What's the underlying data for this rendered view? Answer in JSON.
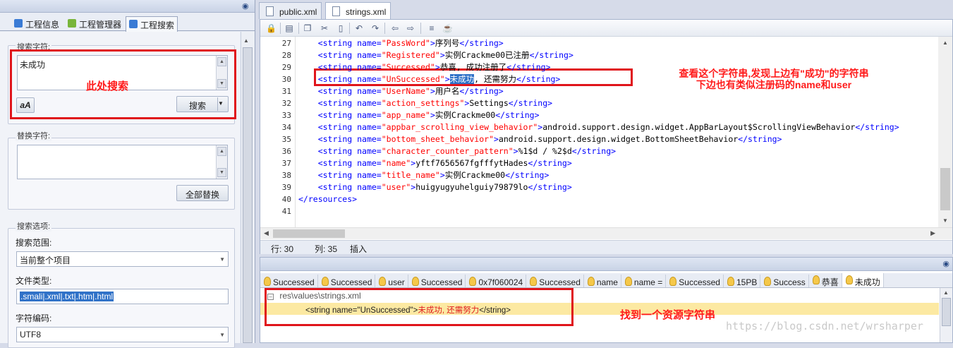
{
  "left_panel": {
    "tabs": [
      {
        "label": "工程信息",
        "icon": "info-icon",
        "color": "#3a7bd5"
      },
      {
        "label": "工程管理器",
        "icon": "android-icon",
        "color": "#78b53a"
      },
      {
        "label": "工程搜索",
        "icon": "search-icon",
        "color": "#3a7bd5"
      }
    ],
    "search_group_label": "搜索字符:",
    "search_text": "未成功",
    "font_button": "aA",
    "search_button": "搜索",
    "replace_group_label": "替换字符:",
    "replace_text": "",
    "replace_all_button": "全部替换",
    "options_group_label": "搜索选项:",
    "scope_label": "搜索范围:",
    "scope_value": "当前整个项目",
    "filetype_label": "文件类型:",
    "filetype_value": ".smali|.xml|.txt|.htm|.html",
    "encoding_label": "字符编码:",
    "encoding_value": "UTF8"
  },
  "annotations": {
    "search_here": "此处搜索",
    "note_line1": "查看这个字符串,发现上边有\"成功\"的字符串",
    "note_line2": "下边也有类似注册码的name和user",
    "found": "找到一个资源字符串"
  },
  "editor": {
    "tabs": [
      {
        "label": "public.xml",
        "active": false
      },
      {
        "label": "strings.xml",
        "active": true
      }
    ],
    "lines": [
      {
        "n": "27",
        "name": "PassWord",
        "text": "序列号"
      },
      {
        "n": "28",
        "name": "Registered",
        "text": "实例Crackme00已注册"
      },
      {
        "n": "29",
        "name": "Successed",
        "text": "恭喜, 成功注册了"
      },
      {
        "n": "30",
        "name": "UnSuccessed",
        "sel": "未成功",
        "text": ", 还需努力"
      },
      {
        "n": "31",
        "name": "UserName",
        "text": "用户名"
      },
      {
        "n": "32",
        "name": "action_settings",
        "text": "Settings"
      },
      {
        "n": "33",
        "name": "app_name",
        "text": "实例Crackme00"
      },
      {
        "n": "34",
        "name": "appbar_scrolling_view_behavior",
        "text": "android.support.design.widget.AppBarLayout$ScrollingViewBehavior"
      },
      {
        "n": "35",
        "name": "bottom_sheet_behavior",
        "text": "android.support.design.widget.BottomSheetBehavior"
      },
      {
        "n": "36",
        "name": "character_counter_pattern",
        "text": "%1$d / %2$d"
      },
      {
        "n": "37",
        "name": "name",
        "text": "yftf7656567fgfffytHades"
      },
      {
        "n": "38",
        "name": "title_name",
        "text": "实例Crackme00"
      },
      {
        "n": "39",
        "name": "user",
        "text": "huigyugyuhelguiy79879lo"
      }
    ],
    "line40": "40",
    "line41": "41",
    "closing": "</resources>",
    "tag_open": "<string name=",
    "tag_close": "</string>",
    "status_row_label": "行: 30",
    "status_col_label": "列: 35",
    "status_mode": "插入"
  },
  "results": {
    "tabs": [
      "Successed",
      "Successed",
      "user",
      "Successed",
      "0x7f060024",
      "Successed",
      "name",
      "name =",
      "Successed",
      "15PB",
      "Success",
      "恭喜",
      "未成功"
    ],
    "file_path": "res\\values\\strings.xml",
    "match_prefix": "<string name=\"UnSuccessed\">",
    "match_hit": "未成功, 还需努力",
    "match_suffix": "</string>",
    "watermark": "https://blog.csdn.net/wrsharper"
  }
}
